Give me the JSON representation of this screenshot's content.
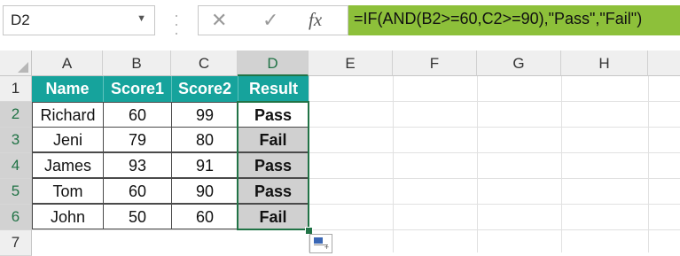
{
  "name_box": {
    "value": "D2"
  },
  "formula_bar": {
    "cancel_icon": "close-icon",
    "enter_icon": "check-icon",
    "fx_label": "fx",
    "formula": "=IF(AND(B2>=60,C2>=90),\"Pass\",\"Fail\")",
    "formula_bg": "#8dc03a"
  },
  "columns": [
    "A",
    "B",
    "C",
    "D",
    "E",
    "F",
    "G",
    "H"
  ],
  "rows": [
    "1",
    "2",
    "3",
    "4",
    "5",
    "6",
    "7"
  ],
  "table": {
    "headers": [
      "Name",
      "Score1",
      "Score2",
      "Result"
    ],
    "header_color": "#16a39c",
    "data": [
      [
        "Richard",
        "60",
        "99",
        "Pass"
      ],
      [
        "Jeni",
        "79",
        "80",
        "Fail"
      ],
      [
        "James",
        "93",
        "91",
        "Pass"
      ],
      [
        "Tom",
        "60",
        "90",
        "Pass"
      ],
      [
        "John",
        "50",
        "60",
        "Fail"
      ]
    ]
  },
  "selection": {
    "active_cell": "D2",
    "range": "D2:D6",
    "accent": "#217346"
  }
}
